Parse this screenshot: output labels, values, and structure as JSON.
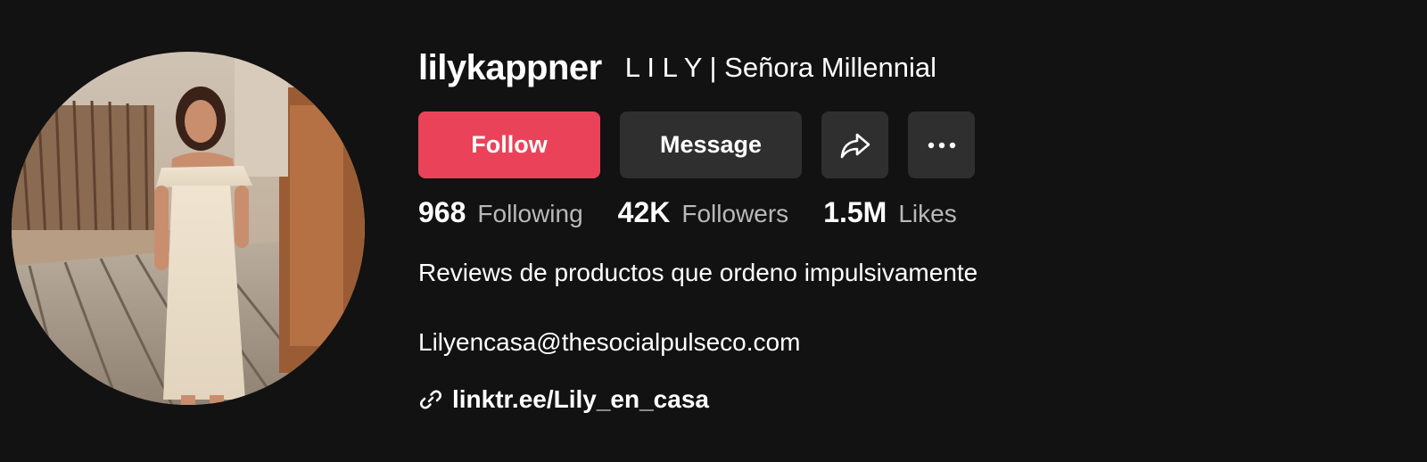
{
  "profile": {
    "username": "lilykappner",
    "nickname": "L I L Y | Señora Millennial"
  },
  "actions": {
    "follow_label": "Follow",
    "message_label": "Message",
    "share_icon": "share-icon",
    "more_icon": "more-icon"
  },
  "stats": [
    {
      "value": "968",
      "label": "Following"
    },
    {
      "value": "42K",
      "label": "Followers"
    },
    {
      "value": "1.5M",
      "label": "Likes"
    }
  ],
  "bio": {
    "line1": "Reviews de productos que ordeno impulsivamente",
    "line2": "Lilyencasa@thesocialpulseco.com"
  },
  "link": {
    "icon": "link-icon",
    "text": "linktr.ee/Lily_en_casa"
  },
  "colors": {
    "background": "#121212",
    "follow_button": "#ea4359",
    "secondary_button": "#2f2f2f",
    "muted_text": "#b9b9b9"
  }
}
